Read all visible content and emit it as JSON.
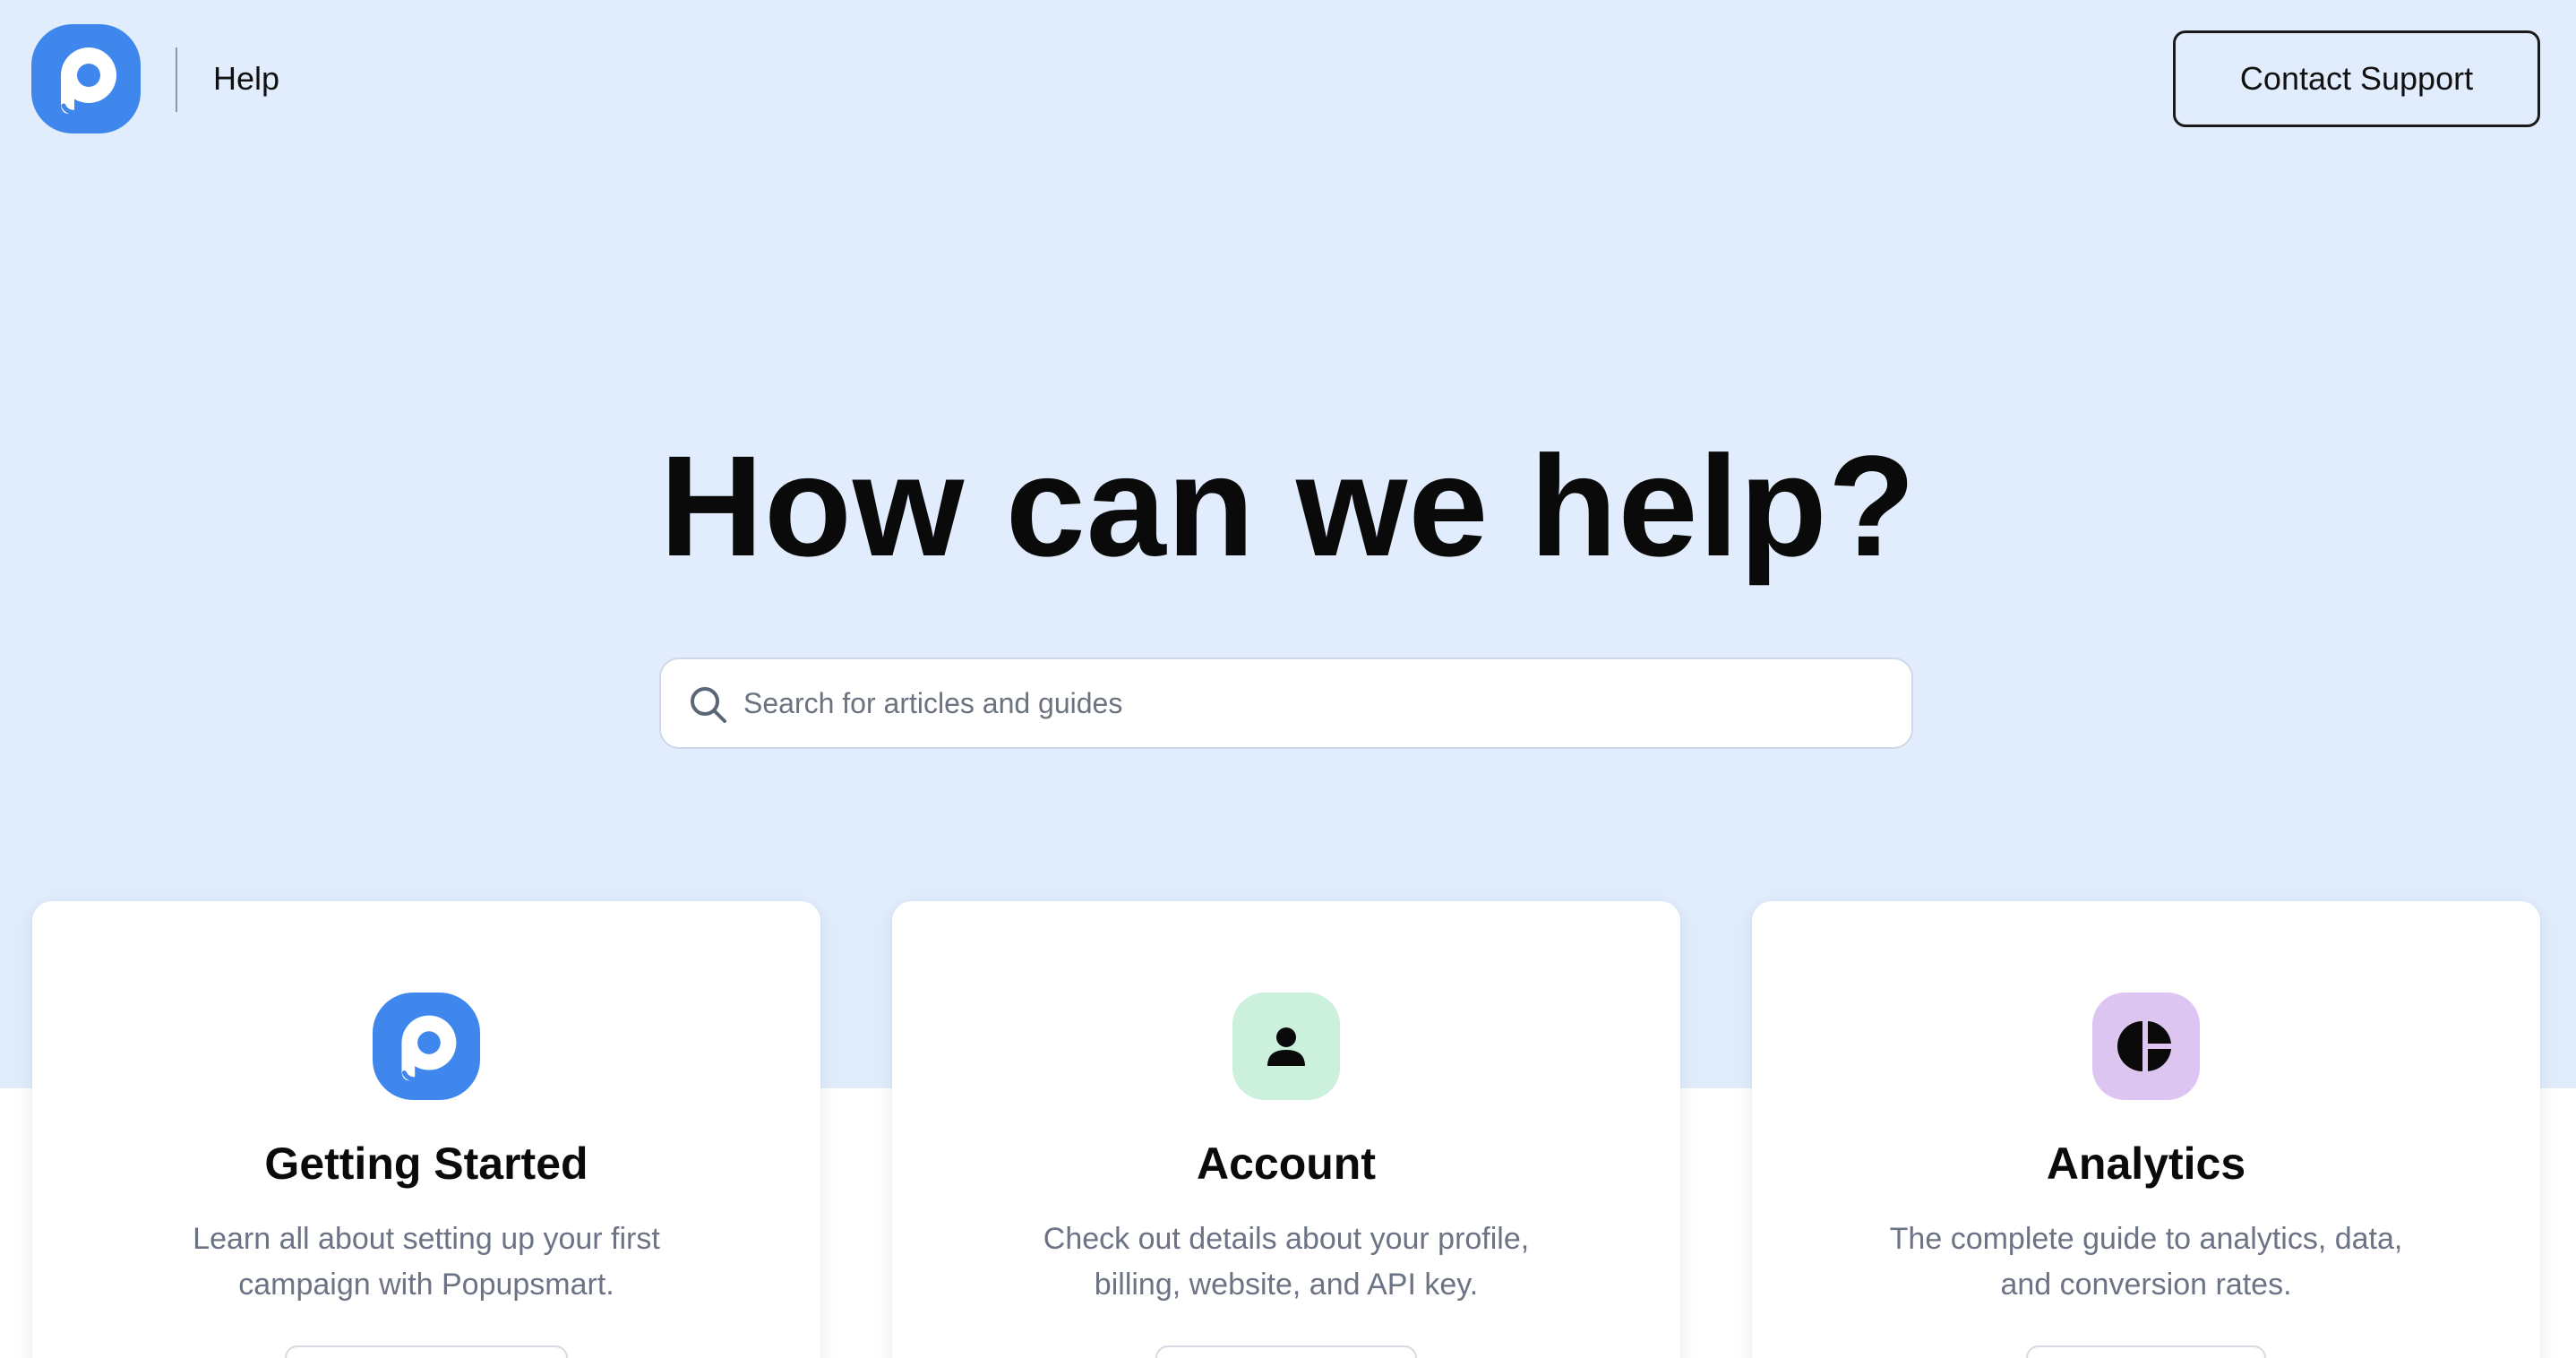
{
  "header": {
    "logo_icon": "popupsmart-logo-icon",
    "help_label": "Help",
    "contact_label": "Contact Support"
  },
  "hero": {
    "title": "How can we help?",
    "search": {
      "icon": "search-icon",
      "placeholder": "Search for articles and guides"
    }
  },
  "colors": {
    "hero_background": "#e1edfc",
    "brand_blue": "#3f87ec",
    "account_green": "#cbf0db",
    "analytics_purple": "#dcc6f1",
    "description_gray": "#6b7384"
  },
  "cards": [
    {
      "icon": "popupsmart-logo-icon",
      "title": "Getting Started",
      "description": "Learn all about setting up your first campaign with Popupsmart."
    },
    {
      "icon": "user-icon",
      "title": "Account",
      "description": "Check out details about your profile, billing, website, and API key."
    },
    {
      "icon": "pie-chart-icon",
      "title": "Analytics",
      "description": "The complete guide to analytics, data, and conversion rates."
    }
  ]
}
